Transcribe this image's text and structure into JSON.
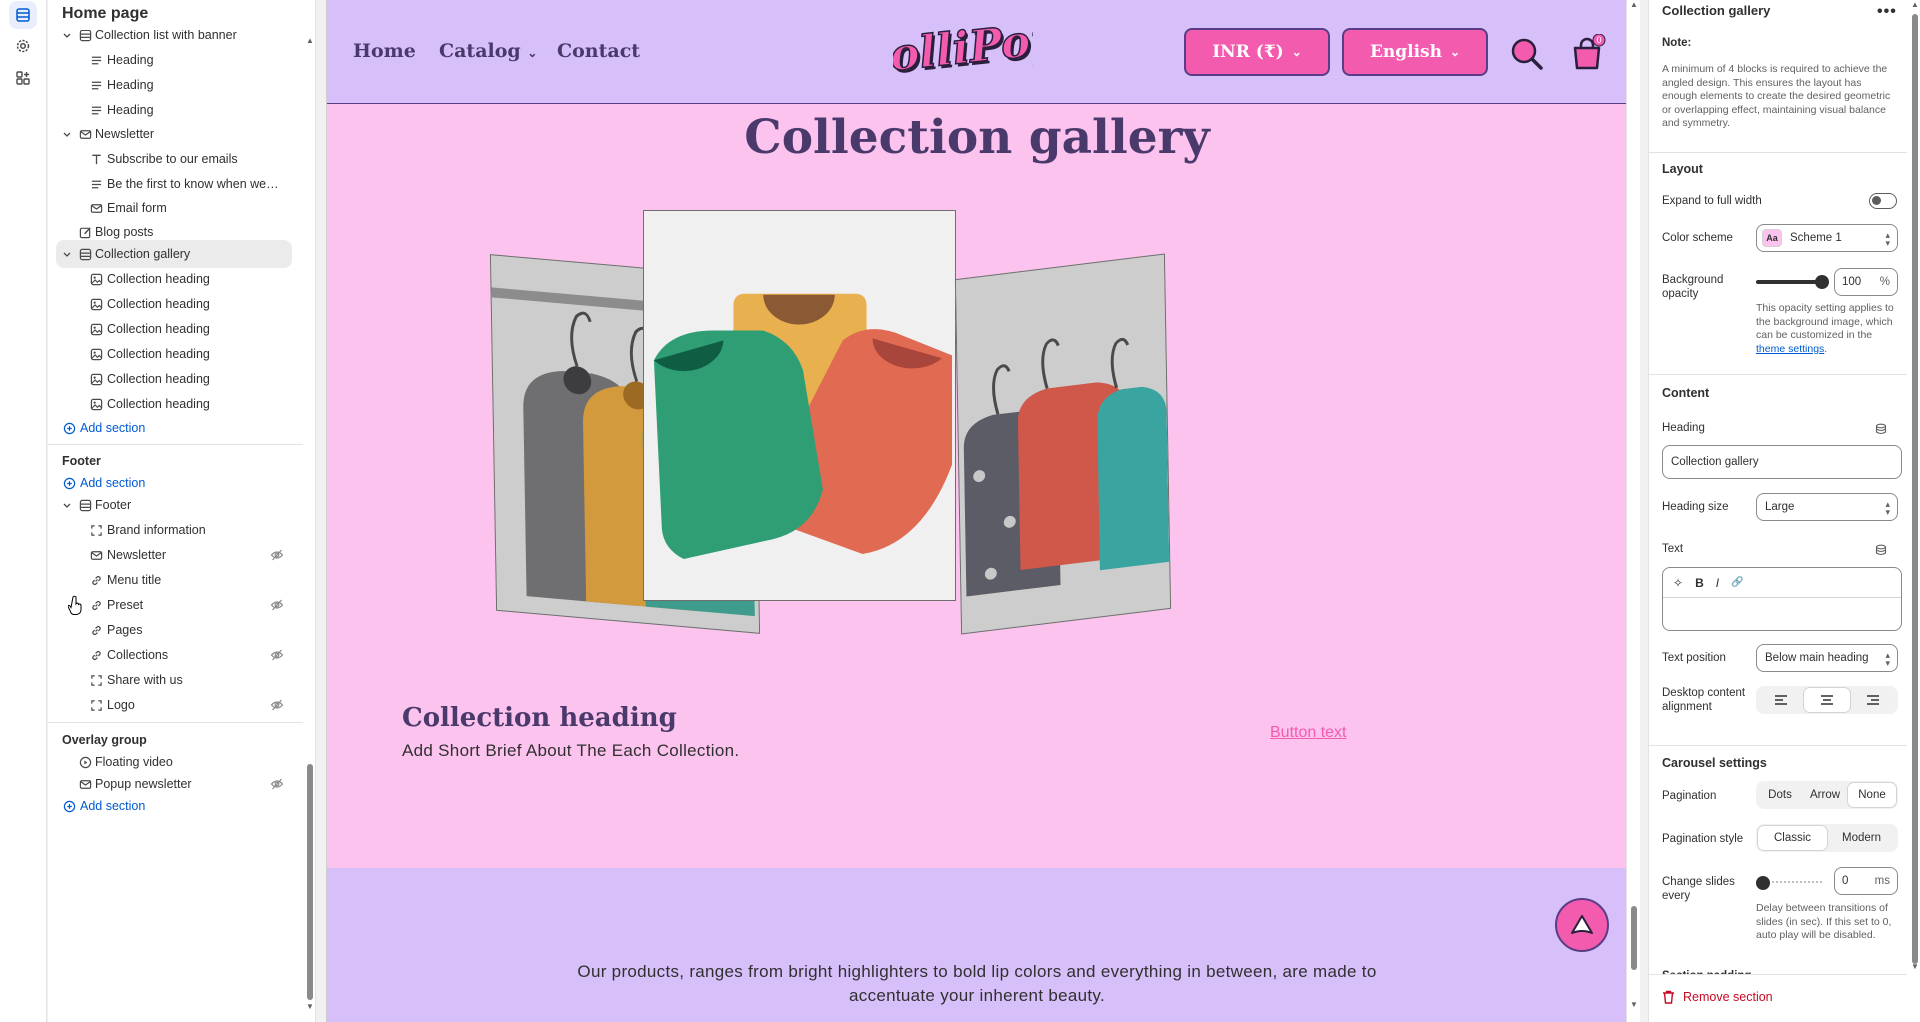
{
  "left_panel": {
    "title": "Home page",
    "tree": [
      {
        "label": "Collection list with banner",
        "icon": "layout-icon",
        "level": 0,
        "chevron": "down"
      },
      {
        "label": "Heading",
        "icon": "text-lines-icon",
        "level": 1
      },
      {
        "label": "Heading",
        "icon": "text-lines-icon",
        "level": 1
      },
      {
        "label": "Heading",
        "icon": "text-lines-icon",
        "level": 1
      },
      {
        "label": "Newsletter",
        "icon": "envelope-icon",
        "level": 0,
        "chevron": "down"
      },
      {
        "label": "Subscribe to our emails",
        "icon": "text-t-icon",
        "level": 1
      },
      {
        "label": "Be the first to know when we la...",
        "icon": "text-lines-icon",
        "level": 1
      },
      {
        "label": "Email form",
        "icon": "envelope-icon",
        "level": 1
      },
      {
        "label": "Blog posts",
        "icon": "edit-icon",
        "level": 0
      },
      {
        "label": "Collection gallery",
        "icon": "layout-icon",
        "level": 0,
        "chevron": "down",
        "selected": true
      },
      {
        "label": "Collection heading",
        "icon": "image-icon",
        "level": 1
      },
      {
        "label": "Collection heading",
        "icon": "image-icon",
        "level": 1
      },
      {
        "label": "Collection heading",
        "icon": "image-icon",
        "level": 1
      },
      {
        "label": "Collection heading",
        "icon": "image-icon",
        "level": 1
      },
      {
        "label": "Collection heading",
        "icon": "image-icon",
        "level": 1
      },
      {
        "label": "Collection heading",
        "icon": "image-icon",
        "level": 1
      }
    ],
    "add_section_label": "Add section",
    "footer_group_label": "Footer",
    "footer_tree": [
      {
        "label": "Footer",
        "icon": "layout-icon",
        "level": 0,
        "chevron": "down"
      },
      {
        "label": "Brand information",
        "icon": "frame-icon",
        "level": 1
      },
      {
        "label": "Newsletter",
        "icon": "envelope-icon",
        "level": 1,
        "hidden": true
      },
      {
        "label": "Menu title",
        "icon": "link-icon",
        "level": 1
      },
      {
        "label": "Preset",
        "icon": "link-icon",
        "level": 1,
        "hidden": true
      },
      {
        "label": "Pages",
        "icon": "link-icon",
        "level": 1
      },
      {
        "label": "Collections",
        "icon": "link-icon",
        "level": 1,
        "hidden": true
      },
      {
        "label": "Share with us",
        "icon": "frame-icon",
        "level": 1
      },
      {
        "label": "Logo",
        "icon": "frame-icon",
        "level": 1,
        "hidden": true
      }
    ],
    "overlay_group_label": "Overlay group",
    "overlay_tree": [
      {
        "label": "Floating video",
        "icon": "play-icon",
        "level": 0
      },
      {
        "label": "Popup newsletter",
        "icon": "envelope-icon",
        "level": 0,
        "hidden": true
      }
    ]
  },
  "preview": {
    "nav": [
      "Home",
      "Catalog",
      "Contact"
    ],
    "logo_text": "LolliPop",
    "currency_label": "INR (₹)",
    "language_label": "English",
    "cart_count": "0",
    "section_title": "Collection gallery",
    "collection_heading": "Collection heading",
    "collection_desc": "Add Short Brief About The Each Collection.",
    "button_text": "Button text",
    "footer_text": "Our products, ranges from bright highlighters to bold lip colors and everything in between, are made to accentuate your inherent beauty.",
    "colors": {
      "header_bg": "#d7bff9",
      "section_bg": "#fcc3ee",
      "accent": "#f25bae",
      "heading": "#4a3a6b"
    }
  },
  "settings": {
    "title": "Collection gallery",
    "more_label": "•••",
    "note_label": "Note:",
    "note_text": "A minimum of 4 blocks is required to achieve the angled design. This ensures the layout has enough elements to create the desired geometric or overlapping effect, maintaining visual balance and symmetry.",
    "layout_header": "Layout",
    "expand_label": "Expand to full width",
    "expand_on": false,
    "color_scheme_label": "Color scheme",
    "color_scheme_value": "Scheme 1",
    "color_scheme_swatch": "Aa",
    "bg_opacity_label": "Background opacity",
    "bg_opacity_value": "100",
    "bg_opacity_unit": "%",
    "bg_opacity_help": "This opacity setting applies to the background image, which can be customized in the",
    "bg_opacity_link": "theme settings",
    "bg_opacity_help_end": ".",
    "content_header": "Content",
    "heading_label": "Heading",
    "heading_value": "Collection gallery",
    "heading_size_label": "Heading size",
    "heading_size_value": "Large",
    "text_label": "Text",
    "rte_buttons": [
      "✧",
      "B",
      "I",
      "🔗"
    ],
    "text_position_label": "Text position",
    "text_position_value": "Below main heading",
    "desktop_align_label": "Desktop content alignment",
    "desktop_align_selected": "center",
    "carousel_header": "Carousel settings",
    "pagination_label": "Pagination",
    "pagination_options": [
      "Dots",
      "Arrow",
      "None"
    ],
    "pagination_selected": "None",
    "pagination_style_label": "Pagination style",
    "pagination_style_options": [
      "Classic",
      "Modern"
    ],
    "pagination_style_selected": "Classic",
    "change_slides_label": "Change slides every",
    "change_slides_value": "0",
    "change_slides_unit": "ms",
    "change_slides_help": "Delay between transitions of slides (in sec). If this set to 0, auto play will be disabled.",
    "section_padding_label": "Section padding",
    "remove_label": "Remove section"
  }
}
